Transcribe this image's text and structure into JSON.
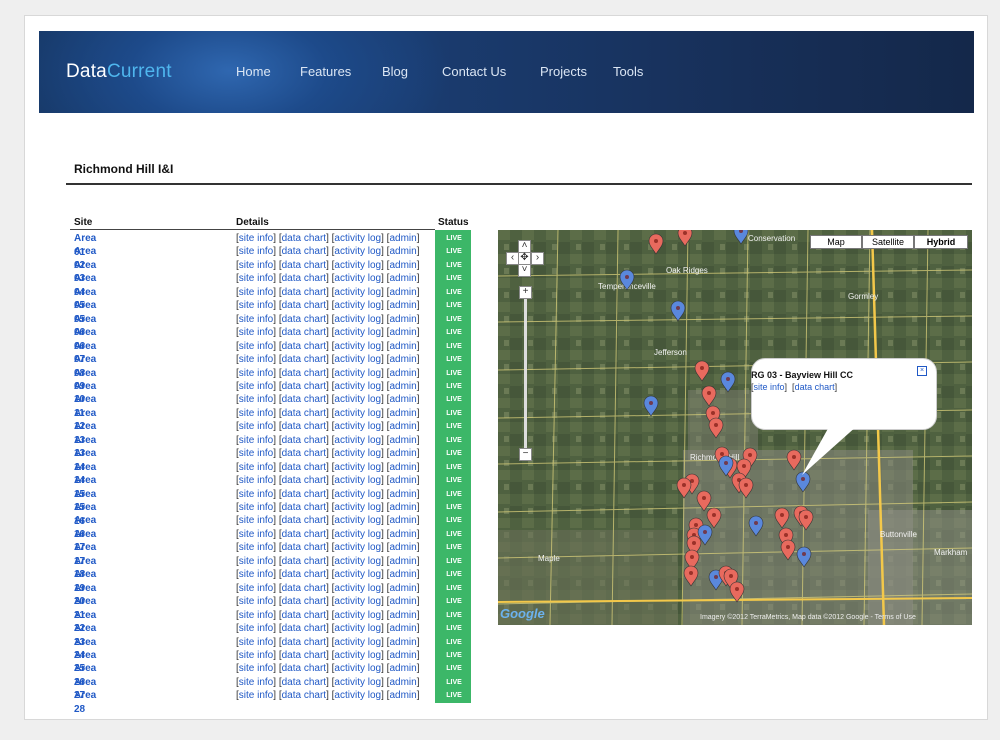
{
  "header": {
    "logo_part1": "Data",
    "logo_part2": "Current",
    "nav": [
      "Home",
      "Features",
      "Blog",
      "Contact Us",
      "Projects",
      "Tools"
    ]
  },
  "page_title": "Richmond Hill I&I",
  "table": {
    "columns": [
      "Site",
      "Details",
      "Status"
    ],
    "detail_links": [
      "site info",
      "data chart",
      "activity log",
      "admin"
    ],
    "status_text": "LIVE",
    "sites": [
      "Area 01",
      "Area 02",
      "Area 03",
      "Area 04",
      "Area 05",
      "Area 05",
      "Area 06",
      "Area 06",
      "Area 07",
      "Area 08",
      "Area 09",
      "Area 10",
      "Area 11",
      "Area 12",
      "Area 13",
      "Area 13",
      "Area 14",
      "Area 14",
      "Area 15",
      "Area 15",
      "Area 16",
      "Area 16",
      "Area 17",
      "Area 17",
      "Area 18",
      "Area 19",
      "Area 20",
      "Area 21",
      "Area 22",
      "Area 23",
      "Area 24",
      "Area 25",
      "Area 26",
      "Area 27",
      "Area 28"
    ]
  },
  "map": {
    "types": [
      "Map",
      "Satellite",
      "Hybrid"
    ],
    "selected_type": "Hybrid",
    "infowindow": {
      "title": "RG 03 - Bayview Hill CC",
      "links": [
        "site info",
        "data chart"
      ]
    },
    "place_labels": [
      "Oak Ridges",
      "Temperanceville",
      "Jefferson",
      "Richmond Hill",
      "Gormley",
      "Markham",
      "Buttonville",
      "Maple",
      "Conservation"
    ],
    "copyright": "Imagery ©2012 TerraMetrics, Map data ©2012 Google - Terms of Use",
    "google_logo": "Google",
    "colors": {
      "red_marker": "#e86a5e",
      "blue_marker": "#5a88dc"
    }
  }
}
